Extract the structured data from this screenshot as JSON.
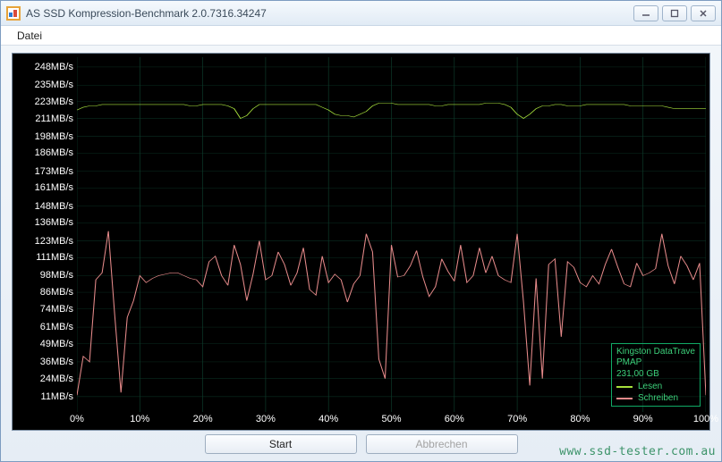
{
  "window": {
    "title": "AS SSD Kompression-Benchmark 2.0.7316.34247"
  },
  "menu": {
    "file": "Datei"
  },
  "buttons": {
    "start": "Start",
    "cancel": "Abbrechen"
  },
  "legend": {
    "device_name": "Kingston DataTrave",
    "device_sub": "PMAP",
    "capacity": "231,00 GB",
    "read": "Lesen",
    "write": "Schreiben"
  },
  "watermark": "www.ssd-tester.com.au",
  "chart_data": {
    "type": "line",
    "title": "",
    "xlabel": "",
    "ylabel": "",
    "xlim": [
      0,
      100
    ],
    "ylim": [
      0,
      255
    ],
    "x_ticks": [
      "0%",
      "10%",
      "20%",
      "30%",
      "40%",
      "50%",
      "60%",
      "70%",
      "80%",
      "90%",
      "100%"
    ],
    "y_ticks": [
      "11MB/s",
      "24MB/s",
      "36MB/s",
      "49MB/s",
      "61MB/s",
      "74MB/s",
      "86MB/s",
      "98MB/s",
      "111MB/s",
      "123MB/s",
      "136MB/s",
      "148MB/s",
      "161MB/s",
      "173MB/s",
      "186MB/s",
      "198MB/s",
      "211MB/s",
      "223MB/s",
      "235MB/s",
      "248MB/s"
    ],
    "x": [
      0,
      1,
      2,
      3,
      4,
      5,
      6,
      7,
      8,
      9,
      10,
      11,
      12,
      13,
      14,
      15,
      16,
      17,
      18,
      19,
      20,
      21,
      22,
      23,
      24,
      25,
      26,
      27,
      28,
      29,
      30,
      31,
      32,
      33,
      34,
      35,
      36,
      37,
      38,
      39,
      40,
      41,
      42,
      43,
      44,
      45,
      46,
      47,
      48,
      49,
      50,
      51,
      52,
      53,
      54,
      55,
      56,
      57,
      58,
      59,
      60,
      61,
      62,
      63,
      64,
      65,
      66,
      67,
      68,
      69,
      70,
      71,
      72,
      73,
      74,
      75,
      76,
      77,
      78,
      79,
      80,
      81,
      82,
      83,
      84,
      85,
      86,
      87,
      88,
      89,
      90,
      91,
      92,
      93,
      94,
      95,
      96,
      97,
      98,
      99,
      100
    ],
    "series": [
      {
        "name": "Lesen",
        "values": [
          217,
          219,
          220,
          220,
          221,
          221,
          221,
          221,
          221,
          221,
          221,
          221,
          221,
          221,
          221,
          221,
          221,
          221,
          220,
          220,
          221,
          221,
          221,
          221,
          220,
          218,
          211,
          213,
          218,
          221,
          221,
          221,
          221,
          221,
          221,
          221,
          221,
          221,
          221,
          219,
          217,
          214,
          213,
          213,
          212,
          214,
          216,
          220,
          222,
          222,
          222,
          221,
          221,
          221,
          221,
          221,
          221,
          220,
          220,
          221,
          221,
          221,
          221,
          221,
          221,
          222,
          222,
          222,
          221,
          219,
          214,
          211,
          214,
          218,
          220,
          220,
          221,
          221,
          220,
          220,
          220,
          221,
          221,
          221,
          221,
          221,
          221,
          221,
          220,
          220,
          220,
          220,
          220,
          220,
          219,
          218,
          218,
          218,
          218,
          218,
          218
        ]
      },
      {
        "name": "Schreiben",
        "values": [
          12,
          40,
          36,
          95,
          100,
          130,
          70,
          14,
          68,
          80,
          98,
          93,
          96,
          98,
          99,
          100,
          100,
          98,
          96,
          95,
          90,
          108,
          112,
          98,
          91,
          120,
          106,
          80,
          99,
          123,
          95,
          98,
          115,
          106,
          91,
          100,
          118,
          88,
          84,
          112,
          93,
          99,
          95,
          79,
          92,
          98,
          128,
          115,
          38,
          24,
          120,
          97,
          98,
          105,
          116,
          97,
          83,
          90,
          110,
          101,
          94,
          120,
          93,
          98,
          118,
          100,
          112,
          98,
          95,
          93,
          128,
          79,
          19,
          96,
          24,
          106,
          110,
          54,
          108,
          104,
          93,
          90,
          98,
          92,
          106,
          117,
          104,
          92,
          90,
          107,
          98,
          100,
          103,
          128,
          105,
          92,
          112,
          105,
          95,
          107,
          12
        ]
      }
    ]
  }
}
